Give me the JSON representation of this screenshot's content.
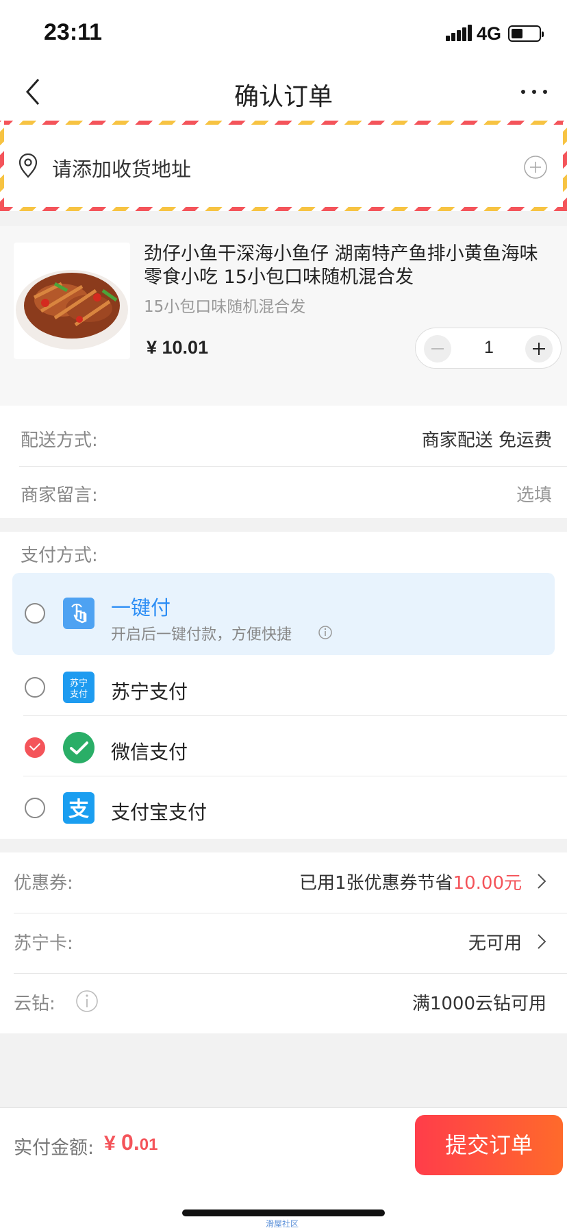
{
  "status_bar": {
    "time": "23:11",
    "network": "4G",
    "battery_level": 0.35
  },
  "nav": {
    "title": "确认订单"
  },
  "address": {
    "placeholder": "请添加收货地址"
  },
  "product": {
    "title": "劲仔小鱼干深海小鱼仔  湖南特产鱼排小黄鱼海味零食小吃 15小包口味随机混合发",
    "subtitle": "15小包口味随机混合发",
    "price": "¥ 10.01",
    "quantity": "1"
  },
  "delivery": {
    "method_label": "配送方式:",
    "method_value": "商家配送 免运费",
    "note_label": "商家留言:",
    "note_placeholder": "选填"
  },
  "payment": {
    "header": "支付方式:",
    "methods": [
      {
        "name": "一键付",
        "desc": "开启后一键付款，方便快捷",
        "selected": false
      },
      {
        "name": "苏宁支付",
        "icon_text": "苏宁\n支付",
        "selected": false
      },
      {
        "name": "微信支付",
        "selected": true
      },
      {
        "name": "支付宝支付",
        "icon_text": "支",
        "selected": false
      }
    ]
  },
  "benefits": {
    "coupon_label": "优惠券:",
    "coupon_prefix": "已用1张优惠券节省",
    "coupon_amount": "10.00元",
    "card_label": "苏宁卡:",
    "card_value": "无可用",
    "diamond_label": "云钻:",
    "diamond_value": "满1000云钻可用"
  },
  "bottom": {
    "total_label": "实付金额:",
    "total_currency": "¥",
    "total_int": "0.",
    "total_dec": "01",
    "submit_label": "提交订单",
    "watermark": "滑屋社区"
  },
  "colors": {
    "accent": "#f4545a",
    "blue": "#2b8df5",
    "wechat": "#2aae67",
    "alipay": "#1a9ef0"
  }
}
